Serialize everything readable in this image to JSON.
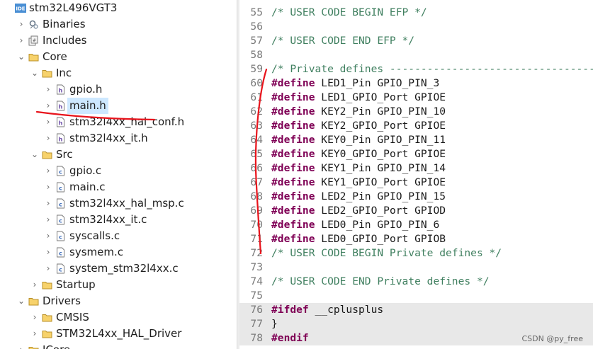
{
  "project_tree": [
    {
      "label": "stm32L496VGT3",
      "icon": "ide-project-icon",
      "arrow": "▾",
      "indent": 0,
      "selected": false
    },
    {
      "label": "Binaries",
      "icon": "binaries-icon",
      "arrow": "›",
      "indent": 1,
      "selected": false
    },
    {
      "label": "Includes",
      "icon": "includes-icon",
      "arrow": "›",
      "indent": 1,
      "selected": false
    },
    {
      "label": "Core",
      "icon": "folder-icon",
      "arrow": "⌄",
      "indent": 1,
      "selected": false
    },
    {
      "label": "Inc",
      "icon": "folder-icon",
      "arrow": "⌄",
      "indent": 2,
      "selected": false
    },
    {
      "label": "gpio.h",
      "icon": "header-file-icon",
      "arrow": "›",
      "indent": 3,
      "selected": false
    },
    {
      "label": "main.h",
      "icon": "header-file-icon",
      "arrow": "›",
      "indent": 3,
      "selected": true
    },
    {
      "label": "stm32l4xx_hal_conf.h",
      "icon": "header-file-icon",
      "arrow": "›",
      "indent": 3,
      "selected": false
    },
    {
      "label": "stm32l4xx_it.h",
      "icon": "header-file-icon",
      "arrow": "›",
      "indent": 3,
      "selected": false
    },
    {
      "label": "Src",
      "icon": "folder-icon",
      "arrow": "⌄",
      "indent": 2,
      "selected": false
    },
    {
      "label": "gpio.c",
      "icon": "c-file-icon",
      "arrow": "›",
      "indent": 3,
      "selected": false
    },
    {
      "label": "main.c",
      "icon": "c-file-icon",
      "arrow": "›",
      "indent": 3,
      "selected": false
    },
    {
      "label": "stm32l4xx_hal_msp.c",
      "icon": "c-file-icon",
      "arrow": "›",
      "indent": 3,
      "selected": false
    },
    {
      "label": "stm32l4xx_it.c",
      "icon": "c-file-icon",
      "arrow": "›",
      "indent": 3,
      "selected": false
    },
    {
      "label": "syscalls.c",
      "icon": "c-file-icon",
      "arrow": "›",
      "indent": 3,
      "selected": false
    },
    {
      "label": "sysmem.c",
      "icon": "c-file-icon",
      "arrow": "›",
      "indent": 3,
      "selected": false
    },
    {
      "label": "system_stm32l4xx.c",
      "icon": "c-file-icon",
      "arrow": "›",
      "indent": 3,
      "selected": false
    },
    {
      "label": "Startup",
      "icon": "folder-icon",
      "arrow": "›",
      "indent": 2,
      "selected": false
    },
    {
      "label": "Drivers",
      "icon": "folder-icon",
      "arrow": "⌄",
      "indent": 1,
      "selected": false
    },
    {
      "label": "CMSIS",
      "icon": "folder-icon",
      "arrow": "›",
      "indent": 2,
      "selected": false
    },
    {
      "label": "STM32L4xx_HAL_Driver",
      "icon": "folder-icon",
      "arrow": "›",
      "indent": 2,
      "selected": false
    },
    {
      "label": "ICore",
      "icon": "folder-icon",
      "arrow": "›",
      "indent": 1,
      "selected": false
    }
  ],
  "code_lines": [
    {
      "num": "55",
      "text": "/* USER CODE BEGIN EFP */",
      "type": "comment",
      "hl": false
    },
    {
      "num": "56",
      "text": "",
      "type": "plain",
      "hl": false
    },
    {
      "num": "57",
      "text": "/* USER CODE END EFP */",
      "type": "comment",
      "hl": false
    },
    {
      "num": "58",
      "text": "",
      "type": "plain",
      "hl": false
    },
    {
      "num": "59",
      "text": "/* Private defines -----------------------------------------------",
      "type": "comment",
      "hl": false
    },
    {
      "num": "60",
      "text": "#define",
      "rest": " LED1_Pin GPIO_PIN_3",
      "type": "directive",
      "hl": false
    },
    {
      "num": "61",
      "text": "#define",
      "rest": " LED1_GPIO_Port GPIOE",
      "type": "directive",
      "hl": false
    },
    {
      "num": "62",
      "text": "#define",
      "rest": " KEY2_Pin GPIO_PIN_10",
      "type": "directive",
      "hl": false
    },
    {
      "num": "63",
      "text": "#define",
      "rest": " KEY2_GPIO_Port GPIOE",
      "type": "directive",
      "hl": false
    },
    {
      "num": "64",
      "text": "#define",
      "rest": " KEY0_Pin GPIO_PIN_11",
      "type": "directive",
      "hl": false
    },
    {
      "num": "65",
      "text": "#define",
      "rest": " KEY0_GPIO_Port GPIOE",
      "type": "directive",
      "hl": false
    },
    {
      "num": "66",
      "text": "#define",
      "rest": " KEY1_Pin GPIO_PIN_14",
      "type": "directive",
      "hl": false
    },
    {
      "num": "67",
      "text": "#define",
      "rest": " KEY1_GPIO_Port GPIOE",
      "type": "directive",
      "hl": false
    },
    {
      "num": "68",
      "text": "#define",
      "rest": " LED2_Pin GPIO_PIN_15",
      "type": "directive",
      "hl": false
    },
    {
      "num": "69",
      "text": "#define",
      "rest": " LED2_GPIO_Port GPIOD",
      "type": "directive",
      "hl": false
    },
    {
      "num": "70",
      "text": "#define",
      "rest": " LED0_Pin GPIO_PIN_6",
      "type": "directive",
      "hl": false
    },
    {
      "num": "71",
      "text": "#define",
      "rest": " LED0_GPIO_Port GPIOB",
      "type": "directive",
      "hl": false
    },
    {
      "num": "72",
      "text": "/* USER CODE BEGIN Private defines */",
      "type": "comment",
      "hl": false
    },
    {
      "num": "73",
      "text": "",
      "type": "plain",
      "hl": false
    },
    {
      "num": "74",
      "text": "/* USER CODE END Private defines */",
      "type": "comment",
      "hl": false
    },
    {
      "num": "75",
      "text": "",
      "type": "plain",
      "hl": false
    },
    {
      "num": "76",
      "text": "#ifdef",
      "rest": " __cplusplus",
      "type": "directive",
      "hl": true
    },
    {
      "num": "77",
      "text": "}",
      "type": "plain",
      "hl": true
    },
    {
      "num": "78",
      "text": "#endif",
      "rest": "",
      "type": "directive",
      "hl": true
    }
  ],
  "watermark": "CSDN @py_free",
  "colors": {
    "comment": "#3f7f5f",
    "keyword": "#7f0055",
    "line_number": "#7a7a7a",
    "selection": "#cde8ff",
    "line_highlight": "#e8e8e8",
    "annotation": "#e8141c"
  }
}
